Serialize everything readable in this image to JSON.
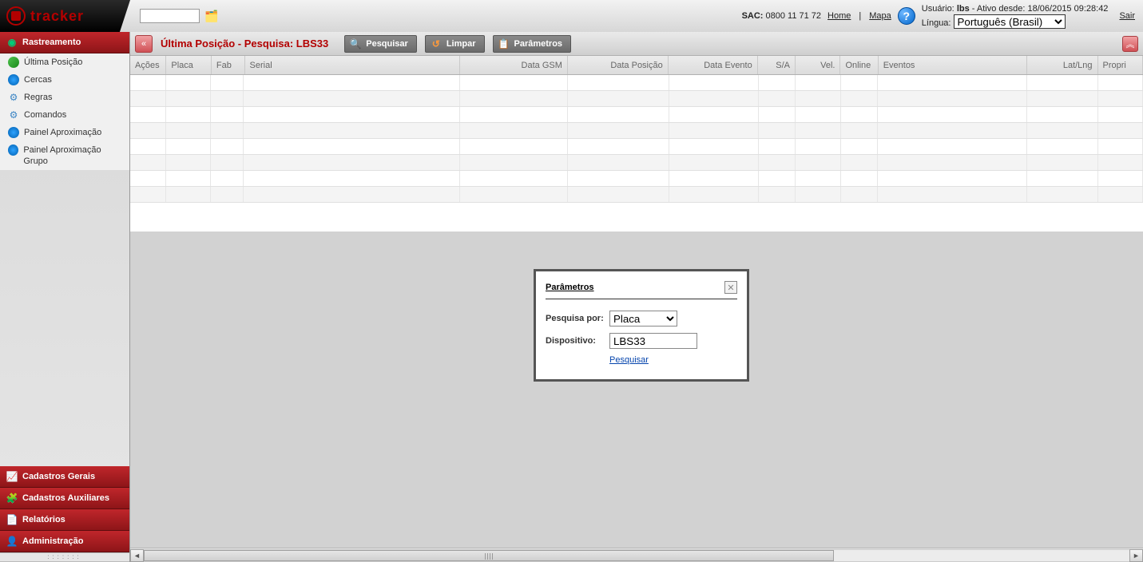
{
  "header": {
    "brand": "tracker",
    "sac_label": "SAC:",
    "sac_value": "0800 11 71 72",
    "home": "Home",
    "mapa": "Mapa",
    "user_label": "Usuário:",
    "user_name": "lbs",
    "ativo": "- Ativo desde:",
    "since": "18/06/2015 09:28:42",
    "lingua_label": "Língua:",
    "lingua_value": "Português (Brasil)",
    "sair": "Sair"
  },
  "sidebar": {
    "cat_rastreamento": "Rastreamento",
    "items": [
      "Última Posição",
      "Cercas",
      "Regras",
      "Comandos",
      "Painel Aproximação",
      "Painel Aproximação Grupo"
    ],
    "cat_cad_gerais": "Cadastros Gerais",
    "cat_cad_aux": "Cadastros Auxiliares",
    "cat_relatorios": "Relatórios",
    "cat_admin": "Administração"
  },
  "toolbar": {
    "title": "Última Posição - Pesquisa: LBS33",
    "pesquisar": "Pesquisar",
    "limpar": "Limpar",
    "parametros": "Parâmetros"
  },
  "grid": {
    "cols": {
      "acoes": "Ações",
      "placa": "Placa",
      "fab": "Fab",
      "serial": "Serial",
      "gsm": "Data GSM",
      "pos": "Data Posição",
      "evt": "Data Evento",
      "sa": "S/A",
      "vel": "Vel.",
      "online": "Online",
      "eventos": "Eventos",
      "latlng": "Lat/Lng",
      "propri": "Propri"
    }
  },
  "dialog": {
    "title": "Parâmetros",
    "pesquisa_por_label": "Pesquisa por:",
    "pesquisa_por_value": "Placa",
    "dispositivo_label": "Dispositivo:",
    "dispositivo_value": "LBS33",
    "pesquisar": "Pesquisar"
  }
}
